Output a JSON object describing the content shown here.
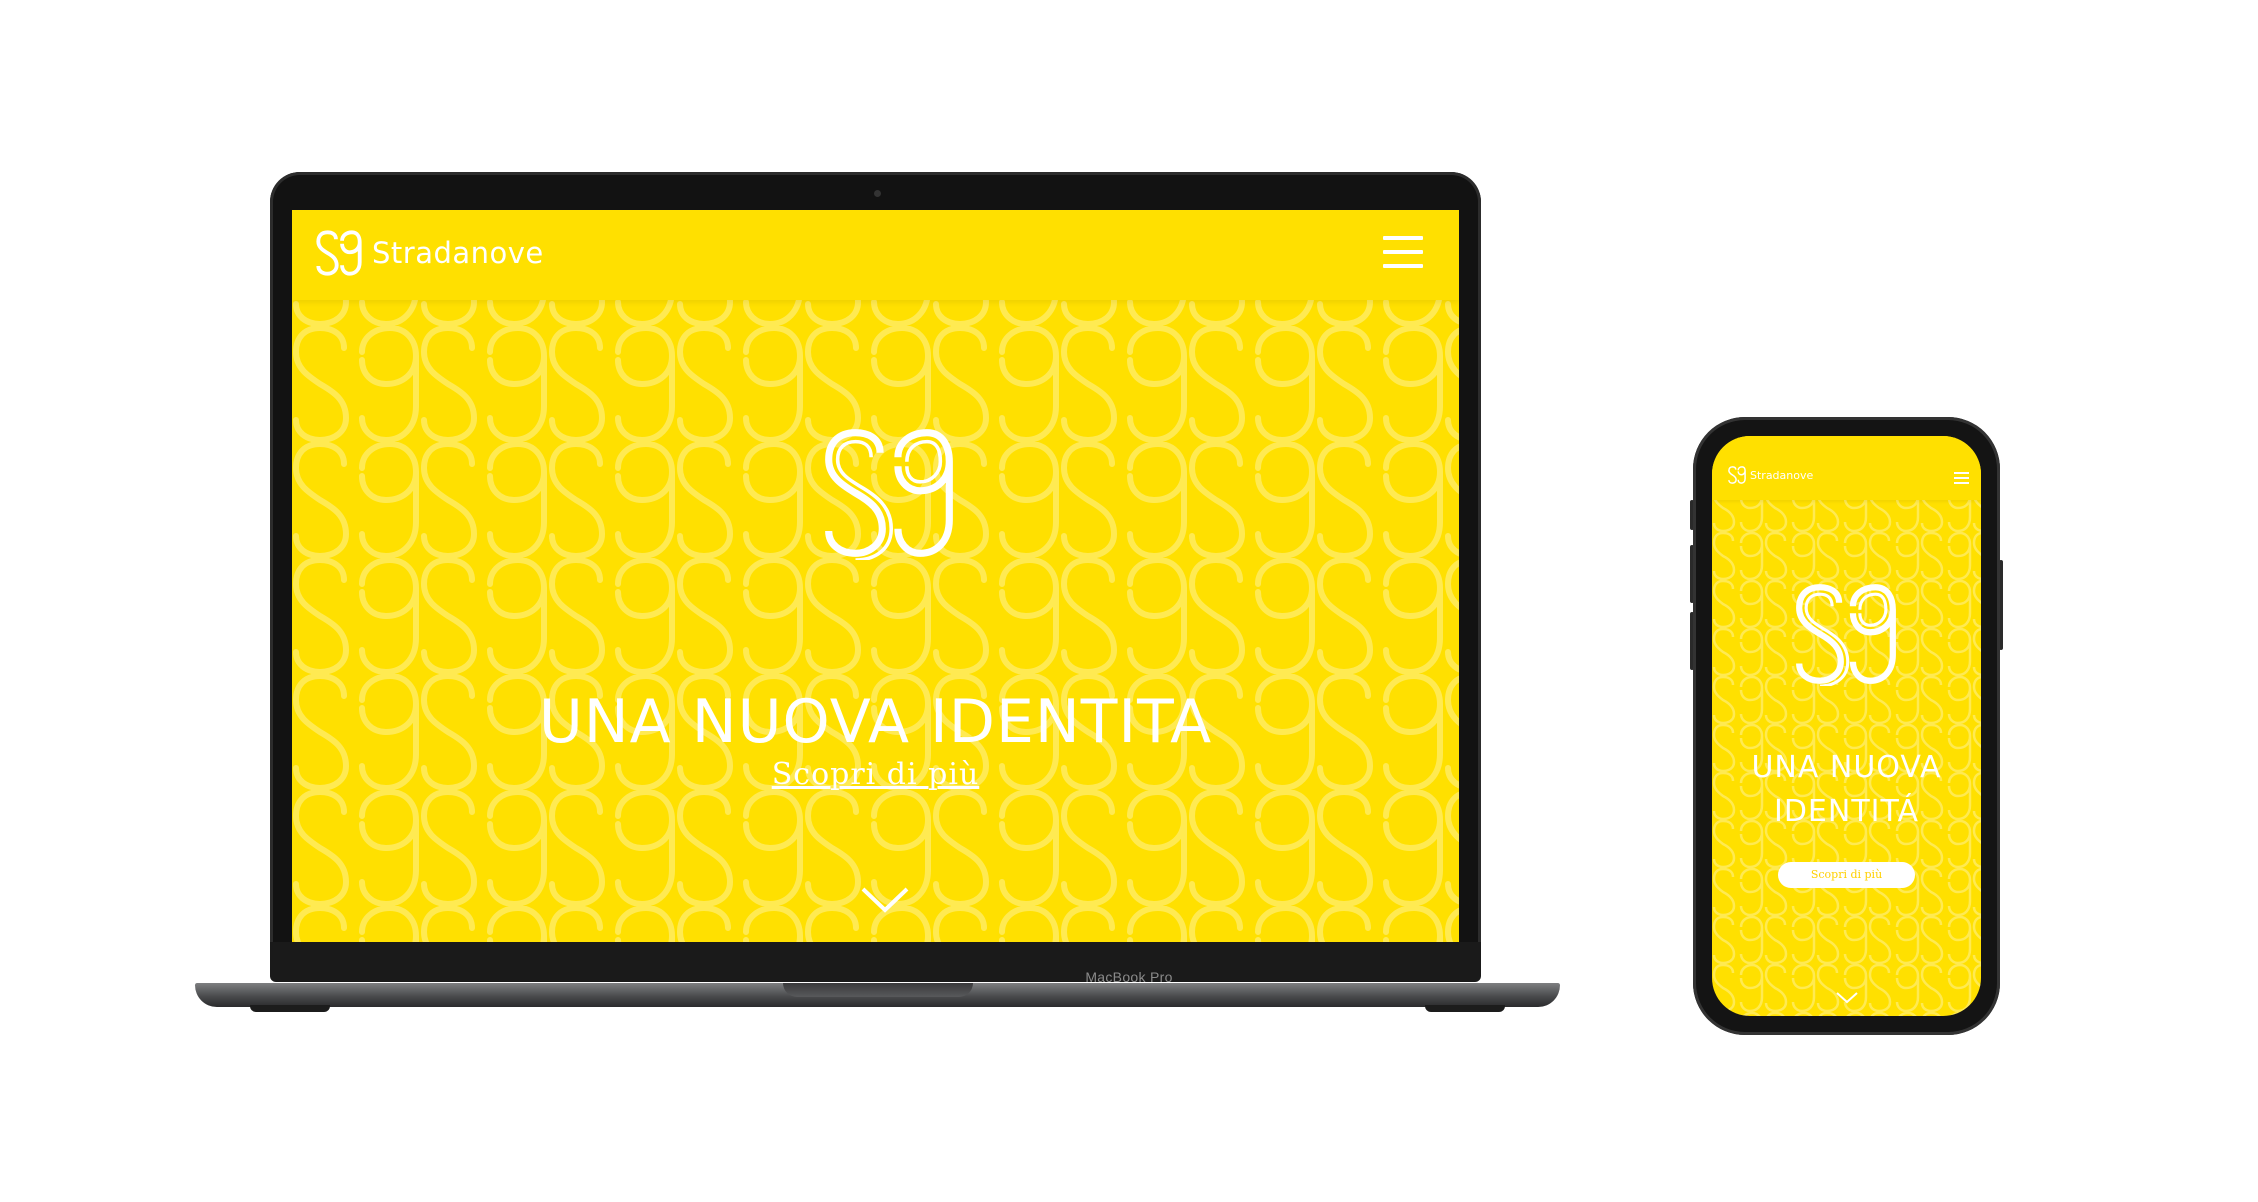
{
  "colors": {
    "brand_yellow": "#ffe000",
    "text_white": "#ffffff",
    "device_dark": "#141414"
  },
  "laptop": {
    "model_label": "MacBook Pro",
    "site": {
      "brand_name": "Stradanove",
      "menu_icon": "hamburger-icon",
      "hero_title": "UNA NUOVA IDENTITA",
      "hero_link": "Scopri di più",
      "scroll_icon": "chevron-down-icon"
    }
  },
  "phone": {
    "site": {
      "brand_name": "Stradanove",
      "menu_icon": "hamburger-icon",
      "hero_title_line1": "UNA NUOVA",
      "hero_title_line2": "IDENTITÁ",
      "hero_button": "Scopri di più",
      "scroll_icon": "chevron-down-icon"
    }
  }
}
